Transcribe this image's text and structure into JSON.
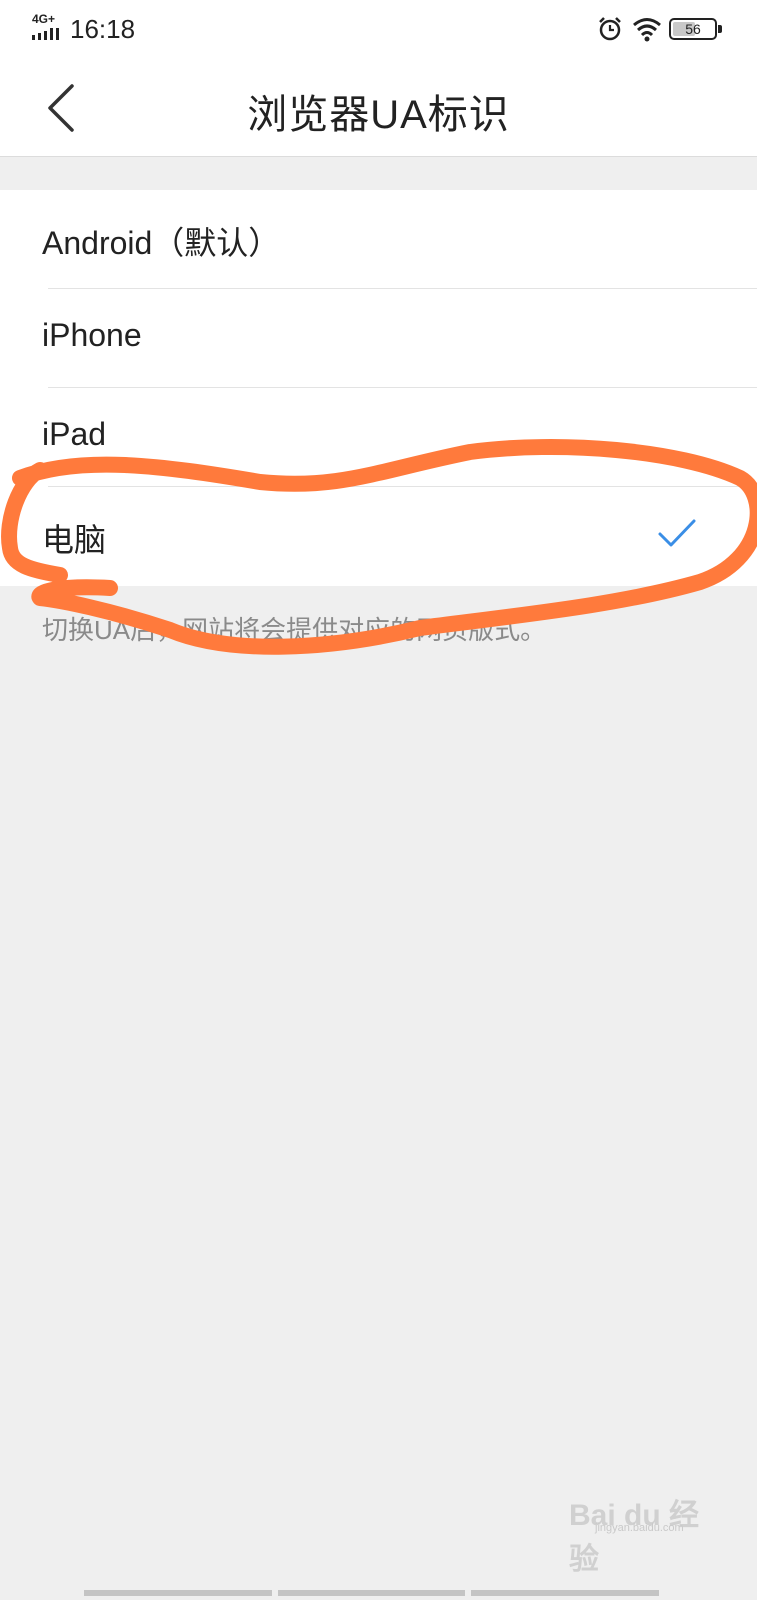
{
  "status_bar": {
    "network": "4G+",
    "time": "16:18",
    "battery": "56",
    "battery_level": 0.56
  },
  "header": {
    "title": "浏览器UA标识"
  },
  "ua_options": [
    {
      "label": "Android（默认）",
      "selected": false
    },
    {
      "label": "iPhone",
      "selected": false
    },
    {
      "label": "iPad",
      "selected": false
    },
    {
      "label": "电脑",
      "selected": true
    }
  ],
  "footnote": "切换UA后，网站将会提供对应的网页版式。",
  "watermark": {
    "brand": "Bai du 经验",
    "url": "jingyan.baidu.com"
  },
  "colors": {
    "check": "#3a8ee6",
    "annotation": "#ff7a3c",
    "background": "#efefef"
  },
  "icons": [
    "signal-icon",
    "alarm-icon",
    "wifi-icon",
    "battery-icon",
    "back-arrow-icon",
    "checkmark-icon"
  ]
}
